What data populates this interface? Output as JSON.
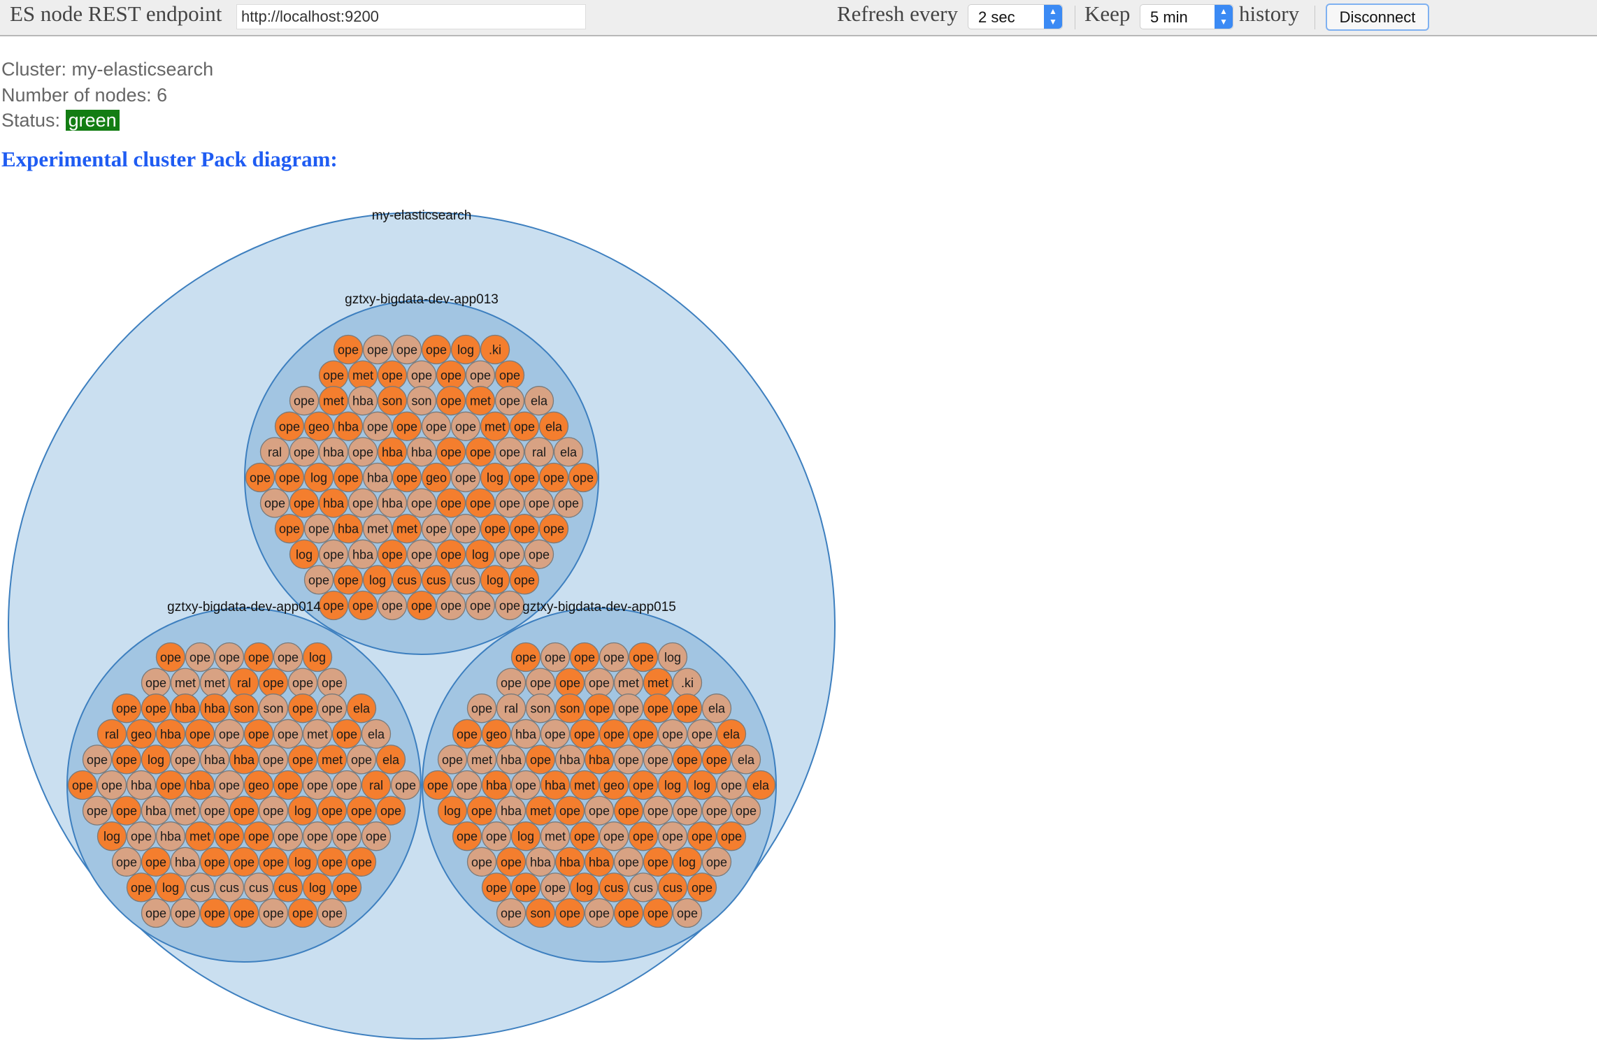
{
  "toolbar": {
    "endpoint_label": "ES node REST endpoint",
    "endpoint_value": "http://localhost:9200",
    "refresh_label": "Refresh every",
    "refresh_value": "2 sec",
    "keep_label": "Keep",
    "keep_value": "5 min",
    "history_label": "history",
    "disconnect_label": "Disconnect"
  },
  "cluster": {
    "name_label": "Cluster:",
    "name": "my-elasticsearch",
    "nodes_label": "Number of nodes:",
    "nodes_count": "6",
    "status_label": "Status:",
    "status": "green",
    "status_color": "#137d13"
  },
  "diagram": {
    "heading": "Experimental cluster Pack diagram:",
    "root_label": "my-elasticsearch",
    "colors": {
      "outer_fill": "#cadff0",
      "node_fill": "#a2c5e2",
      "stroke": "#3d7fbf",
      "primary_shard": "#f47e2e",
      "replica_shard": "#d8a283"
    },
    "nodes": [
      {
        "name": "gztxy-bigdata-dev-app013",
        "rows": [
          "ope:P ope:R ope:R ope:P log:P .ki:P",
          "ope:P met:P ope:P ope:R ope:P ope:R ope:P",
          "ope:R met:P hba:R son:P son:R ope:P met:P ope:R ela:R",
          "ope:P geo:P hba:P ope:R ope:P ope:R ope:R met:P ope:P ela:P",
          "ral:R ope:R hba:R ope:R hba:P hba:R ope:P ope:P ope:R ral:R ela:R",
          "ope:P ope:P log:P ope:P hba:R ope:P geo:P ope:R log:P ope:P ope:P ope:P",
          "ope:R ope:P hba:P ope:R hba:R ope:R ope:P ope:P ope:R ope:R ope:R",
          "ope:P ope:R hba:P met:R met:P ope:R ope:R ope:P ope:P ope:P",
          "log:P ope:R hba:R ope:P ope:R ope:P log:P ope:R ope:R",
          "ope:R ope:P log:P cus:P cus:P cus:R log:P ope:P",
          "ope:P ope:P ope:R ope:P ope:R ope:R ope:R"
        ]
      },
      {
        "name": "gztxy-bigdata-dev-app014",
        "rows": [
          "ope:P ope:R ope:R ope:P ope:R log:P",
          "ope:R met:R met:R ral:P ope:P ope:R ope:R",
          "ope:P ope:P hba:P hba:P son:P son:R ope:P ope:R ela:P",
          "ral:P geo:P hba:P ope:P ope:R ope:P ope:R met:R ope:P ela:R",
          "ope:R ope:P log:P ope:R hba:R hba:P ope:R ope:P met:P ope:R ela:P",
          "ope:P ope:R hba:R ope:P hba:P ope:R geo:P ope:P ope:R ope:R ral:P ope:R",
          "ope:R ope:P hba:R met:R ope:R ope:P ope:R log:P ope:P ope:P ope:P",
          "log:P ope:R hba:R met:P ope:P ope:P ope:R ope:R ope:R ope:R",
          "ope:R ope:P hba:R ope:P ope:P ope:P log:P ope:P ope:P",
          "ope:P log:P cus:R cus:R cus:R cus:P log:P ope:P",
          "ope:R ope:R ope:P ope:P ope:R ope:P ope:R"
        ]
      },
      {
        "name": "gztxy-bigdata-dev-app015",
        "rows": [
          "ope:P ope:R ope:P ope:R ope:P log:R",
          "ope:R ope:R ope:P ope:R met:R met:P .ki:R",
          "ope:R ral:R son:R son:P ope:P ope:R ope:P ope:P ela:R",
          "ope:P geo:P hba:R ope:R ope:P ope:P ope:P ope:R ope:R ela:P",
          "ope:R met:R hba:R ope:P hba:R hba:P ope:R ope:R ope:P ope:P ela:R",
          "ope:P ope:R hba:P ope:R hba:P met:P geo:P ope:P log:P log:P ope:R ela:P",
          "log:P ope:P hba:R met:P ope:P ope:R ope:P ope:R ope:R ope:R ope:R",
          "ope:P ope:R log:P met:R ope:P ope:R ope:P ope:R ope:P ope:P",
          "ope:R ope:P hba:R hba:P hba:P ope:R ope:P log:P ope:R",
          "ope:P ope:P ope:R log:P cus:P cus:R cus:P ope:P",
          "ope:R son:P ope:P ope:R ope:P ope:P ope:R"
        ]
      }
    ]
  }
}
